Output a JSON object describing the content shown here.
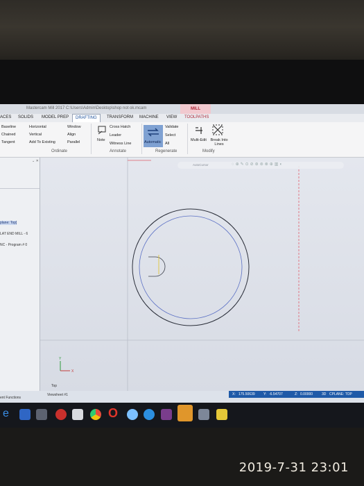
{
  "window": {
    "title": "Mastercam Mill 2017  C:\\Users\\Admin\\Desktop\\shop not ok.mcam",
    "context_tab": "MILL"
  },
  "tabs": [
    {
      "label": "ACES"
    },
    {
      "label": "SOLIDS"
    },
    {
      "label": "MODEL PREP"
    },
    {
      "label": "DRAFTING"
    },
    {
      "label": "TRANSFORM"
    },
    {
      "label": "MACHINE"
    },
    {
      "label": "VIEW"
    },
    {
      "label": "TOOLPATHS"
    }
  ],
  "ribbon": {
    "ordinate": {
      "label": "Ordinate",
      "items": [
        "Baseline",
        "Chained",
        "Tangent",
        "Horizontal",
        "Vertical",
        "Add To Existing",
        "Window",
        "Align",
        "Parallel"
      ]
    },
    "annotate": {
      "label": "Annotate",
      "note": "Note",
      "items": [
        "Cross Hatch",
        "Leader",
        "Witness Line"
      ]
    },
    "regenerate": {
      "label": "Regenerate",
      "automatic": "Automatic",
      "items": [
        "Validate",
        "Select",
        "All"
      ]
    },
    "modify": {
      "label": "Modify",
      "multi_edit": "Multi-Edit",
      "break_into_lines": "Break Into Lines"
    }
  },
  "left_panel": {
    "items": [
      "plane: Top]",
      "LAT END MILL - 6",
      "NC - Program # 0"
    ]
  },
  "viewport": {
    "view_label": "Top",
    "sheet_label": "Viewsheet #1",
    "toolbar_text": "AutoCursor"
  },
  "status": {
    "left": "ent Functions",
    "x_label": "X:",
    "x_value": "175.50639",
    "y_label": "Y:",
    "y_value": "-6.54707",
    "z_label": "Z:",
    "z_value": "0.00000",
    "mode": "3D",
    "cplane": "CPLANE: TOP"
  },
  "photo_timestamp": "2019-7-31 23:01"
}
